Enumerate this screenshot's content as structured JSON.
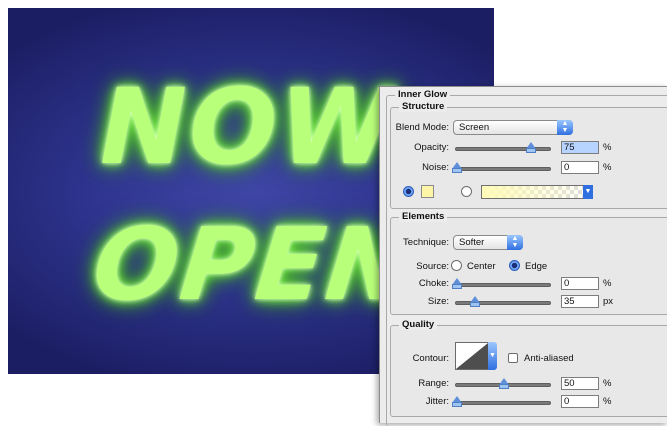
{
  "artwork": {
    "line1": "NOW",
    "line2": "OPEN",
    "glow_color": "#b8ff7a",
    "background_color": "#2f3590"
  },
  "panel": {
    "title": "Inner Glow",
    "structure": {
      "title": "Structure",
      "blend_mode_label": "Blend Mode:",
      "blend_mode_value": "Screen",
      "opacity_label": "Opacity:",
      "opacity_value": "75",
      "opacity_unit": "%",
      "opacity_fraction": 0.75,
      "noise_label": "Noise:",
      "noise_value": "0",
      "noise_unit": "%",
      "color_swatch": "#fdf5a8",
      "solid_color_selected": true
    },
    "elements": {
      "title": "Elements",
      "technique_label": "Technique:",
      "technique_value": "Softer",
      "source_label": "Source:",
      "source_center": "Center",
      "source_edge": "Edge",
      "source_selected": "Edge",
      "choke_label": "Choke:",
      "choke_value": "0",
      "choke_unit": "%",
      "size_label": "Size:",
      "size_value": "35",
      "size_unit": "px"
    },
    "quality": {
      "title": "Quality",
      "contour_label": "Contour:",
      "anti_aliased_label": "Anti-aliased",
      "anti_aliased": false,
      "range_label": "Range:",
      "range_value": "50",
      "range_unit": "%",
      "jitter_label": "Jitter:",
      "jitter_value": "0",
      "jitter_unit": "%"
    }
  }
}
